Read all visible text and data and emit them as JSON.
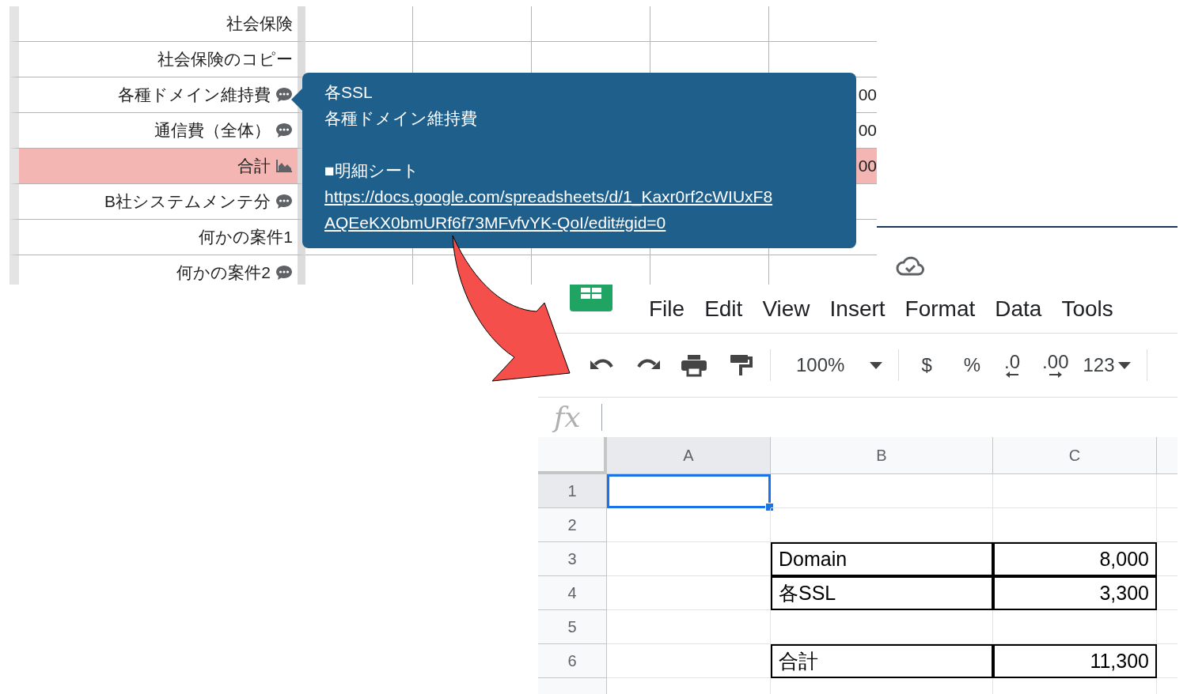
{
  "sheet_excerpt": {
    "rows": [
      {
        "label": "社会保険",
        "kind": "plain",
        "highlighted": false
      },
      {
        "label": "社会保険のコピー",
        "kind": "plain",
        "highlighted": false
      },
      {
        "label": "各種ドメイン維持費",
        "kind": "comment",
        "highlighted": false,
        "column_6": "00"
      },
      {
        "label": "通信費（全体）",
        "kind": "comment",
        "highlighted": false,
        "column_6": "00"
      },
      {
        "label": "合計",
        "kind": "chart",
        "highlighted": true,
        "column_6": "00"
      },
      {
        "label": "B社システムメンテ分",
        "kind": "comment",
        "highlighted": false
      },
      {
        "label": "何かの案件1",
        "kind": "plain",
        "highlighted": false
      },
      {
        "label": "何かの案件2",
        "kind": "comment",
        "highlighted": false
      }
    ]
  },
  "comment_tooltip": {
    "lines": [
      "各SSL",
      "各種ドメイン維持費"
    ],
    "heading": "■明細シート",
    "link": "https://docs.google.com/spreadsheets/d/1_Kaxr0rf2cWIUxF8AQEeKX0bmURf6f73MFvfvYK-QoI/edit#gid=0"
  },
  "spreadsheet": {
    "menu": [
      "File",
      "Edit",
      "View",
      "Insert",
      "Format",
      "Data",
      "Tools"
    ],
    "toolbar": {
      "zoom": "100%",
      "currency": "$",
      "percent": "%",
      "decrease_decimals": ".0",
      "increase_decimals": ".00",
      "number_format": "123"
    },
    "formula_bar": {
      "label": "fx"
    },
    "columns": [
      {
        "label": "A",
        "selected": true
      },
      {
        "label": "B",
        "selected": false
      },
      {
        "label": "C",
        "selected": false
      }
    ],
    "rows": [
      {
        "label": "1",
        "selected": true,
        "cells": [
          {
            "selected": true,
            "bordered": false
          },
          {
            "selected": false,
            "bordered": false
          },
          {
            "selected": false,
            "bordered": false
          }
        ]
      },
      {
        "label": "2",
        "selected": false,
        "cells": [
          {
            "selected": false,
            "bordered": false
          },
          {
            "selected": false,
            "bordered": false
          },
          {
            "selected": false,
            "bordered": false
          }
        ]
      },
      {
        "label": "3",
        "selected": false,
        "cells": [
          {
            "selected": false,
            "bordered": false
          },
          {
            "text": "Domain",
            "selected": false,
            "bordered": true
          },
          {
            "text": "8,000",
            "selected": false,
            "bordered": true
          }
        ]
      },
      {
        "label": "4",
        "selected": false,
        "cells": [
          {
            "selected": false,
            "bordered": false
          },
          {
            "text": "各SSL",
            "selected": false,
            "bordered": true
          },
          {
            "text": "3,300",
            "selected": false,
            "bordered": true
          }
        ]
      },
      {
        "label": "5",
        "selected": false,
        "cells": [
          {
            "selected": false,
            "bordered": false
          },
          {
            "selected": false,
            "bordered": false
          },
          {
            "selected": false,
            "bordered": false
          }
        ]
      },
      {
        "label": "6",
        "selected": false,
        "cells": [
          {
            "selected": false,
            "bordered": false
          },
          {
            "text": "合計",
            "selected": false,
            "bordered": true
          },
          {
            "text": "11,300",
            "selected": false,
            "bordered": true
          }
        ]
      }
    ]
  }
}
